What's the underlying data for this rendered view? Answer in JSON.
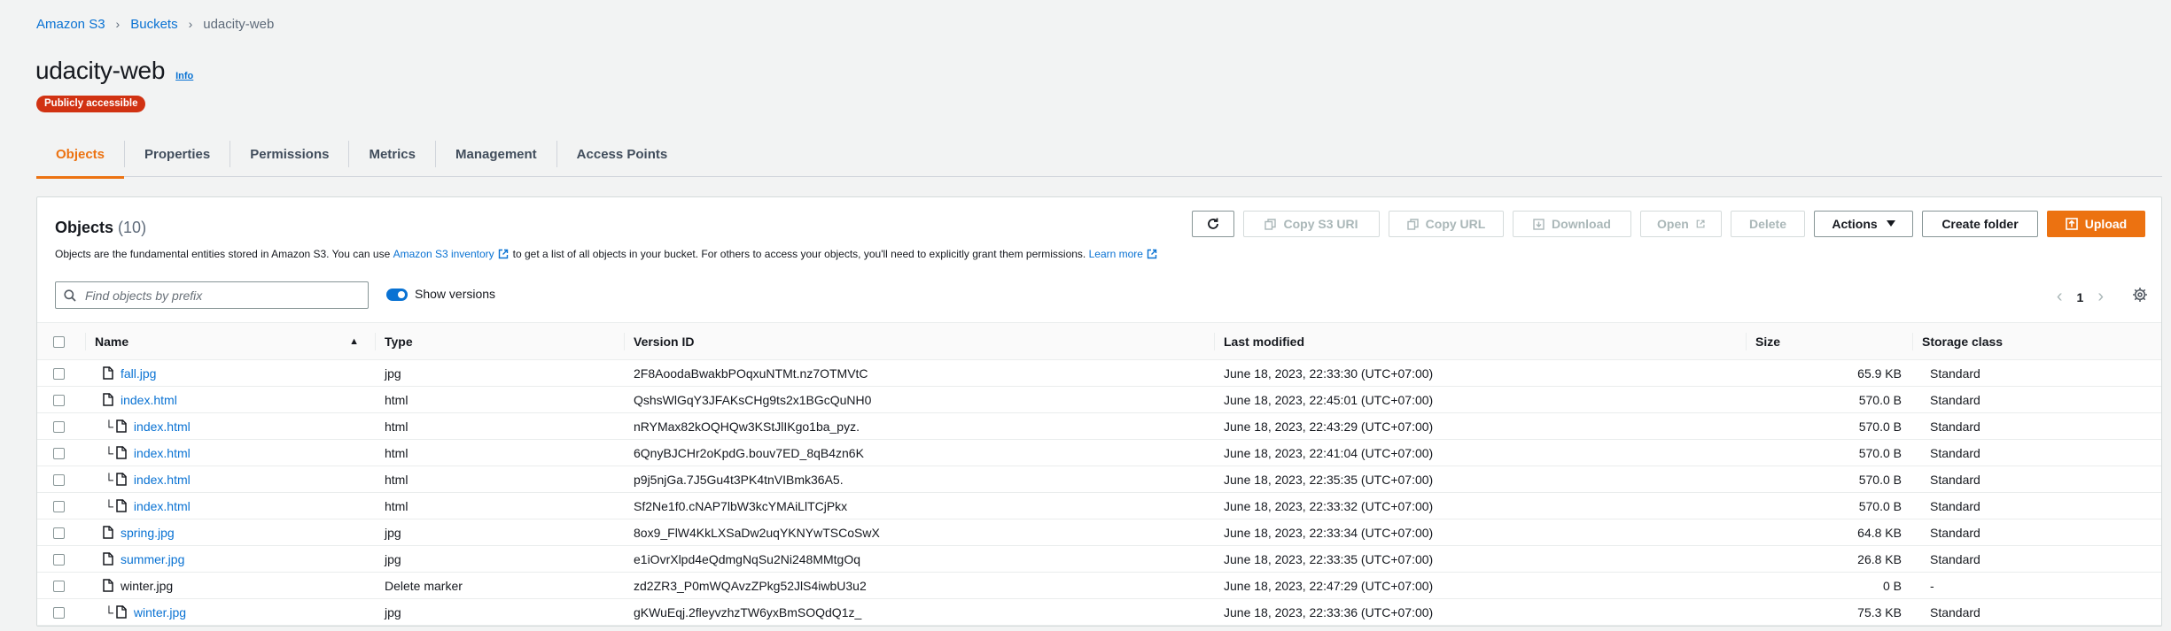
{
  "breadcrumb": {
    "items": [
      "Amazon S3",
      "Buckets"
    ],
    "current": "udacity-web"
  },
  "page": {
    "title": "udacity-web",
    "info": "Info",
    "badge": "Publicly accessible"
  },
  "tabs": [
    "Objects",
    "Properties",
    "Permissions",
    "Metrics",
    "Management",
    "Access Points"
  ],
  "objects": {
    "title": "Objects",
    "count": "(10)",
    "desc_1": "Objects are the fundamental entities stored in Amazon S3. You can use",
    "inventory_link": "Amazon S3 inventory",
    "desc_2": "to get a list of all objects in your bucket. For others to access your objects, you'll need to explicitly grant them permissions.",
    "learn_more": "Learn more"
  },
  "toolbar": {
    "copy_uri": "Copy S3 URI",
    "copy_url": "Copy URL",
    "download": "Download",
    "open": "Open",
    "delete": "Delete",
    "actions": "Actions",
    "create_folder": "Create folder",
    "upload": "Upload"
  },
  "filter": {
    "placeholder": "Find objects by prefix",
    "show_versions": "Show versions"
  },
  "pager": {
    "page": "1"
  },
  "columns": [
    "Name",
    "Type",
    "Version ID",
    "Last modified",
    "Size",
    "Storage class"
  ],
  "rows": [
    {
      "name": "fall.jpg",
      "type": "jpg",
      "version": "2F8AoodaBwakbPOqxuNTMt.nz7OTMVtC",
      "modified": "June 18, 2023, 22:33:30 (UTC+07:00)",
      "size": "65.9 KB",
      "storage": "Standard",
      "child": false,
      "link": true
    },
    {
      "name": "index.html",
      "type": "html",
      "version": "QshsWlGqY3JFAKsCHg9ts2x1BGcQuNH0",
      "modified": "June 18, 2023, 22:45:01 (UTC+07:00)",
      "size": "570.0 B",
      "storage": "Standard",
      "child": false,
      "link": true
    },
    {
      "name": "index.html",
      "type": "html",
      "version": "nRYMax82kOQHQw3KStJlIKgo1ba_pyz.",
      "modified": "June 18, 2023, 22:43:29 (UTC+07:00)",
      "size": "570.0 B",
      "storage": "Standard",
      "child": true,
      "link": true
    },
    {
      "name": "index.html",
      "type": "html",
      "version": "6QnyBJCHr2oKpdG.bouv7ED_8qB4zn6K",
      "modified": "June 18, 2023, 22:41:04 (UTC+07:00)",
      "size": "570.0 B",
      "storage": "Standard",
      "child": true,
      "link": true
    },
    {
      "name": "index.html",
      "type": "html",
      "version": "p9j5njGa.7J5Gu4t3PK4tnVIBmk36A5.",
      "modified": "June 18, 2023, 22:35:35 (UTC+07:00)",
      "size": "570.0 B",
      "storage": "Standard",
      "child": true,
      "link": true
    },
    {
      "name": "index.html",
      "type": "html",
      "version": "Sf2Ne1f0.cNAP7lbW3kcYMAiLlTCjPkx",
      "modified": "June 18, 2023, 22:33:32 (UTC+07:00)",
      "size": "570.0 B",
      "storage": "Standard",
      "child": true,
      "link": true
    },
    {
      "name": "spring.jpg",
      "type": "jpg",
      "version": "8ox9_FlW4KkLXSaDw2uqYKNYwTSCoSwX",
      "modified": "June 18, 2023, 22:33:34 (UTC+07:00)",
      "size": "64.8 KB",
      "storage": "Standard",
      "child": false,
      "link": true
    },
    {
      "name": "summer.jpg",
      "type": "jpg",
      "version": "e1iOvrXlpd4eQdmgNqSu2Ni248MMtgOq",
      "modified": "June 18, 2023, 22:33:35 (UTC+07:00)",
      "size": "26.8 KB",
      "storage": "Standard",
      "child": false,
      "link": true
    },
    {
      "name": "winter.jpg",
      "type": "Delete marker",
      "version": "zd2ZR3_P0mWQAvzZPkg52JlS4iwbU3u2",
      "modified": "June 18, 2023, 22:47:29 (UTC+07:00)",
      "size": "0 B",
      "storage": "-",
      "child": false,
      "link": false
    },
    {
      "name": "winter.jpg",
      "type": "jpg",
      "version": "gKWuEqj.2fleyvzhzTW6yxBmSOQdQ1z_",
      "modified": "June 18, 2023, 22:33:36 (UTC+07:00)",
      "size": "75.3 KB",
      "storage": "Standard",
      "child": true,
      "link": true
    }
  ],
  "colors": {
    "accent": "#ec7211",
    "link": "#0972d3",
    "danger": "#d13212"
  }
}
